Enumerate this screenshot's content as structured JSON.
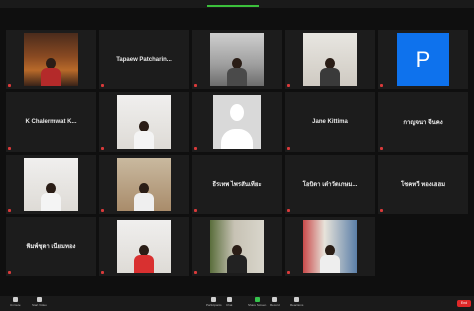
{
  "meeting": {
    "participants": [
      {
        "id": "t1",
        "name": "",
        "type": "video",
        "scene": "scene-red",
        "shirt": "#b42a2a"
      },
      {
        "id": "t2",
        "name": "Tapaew Patcharin...",
        "type": "name"
      },
      {
        "id": "t3",
        "name": "",
        "type": "video",
        "scene": "scene-grey",
        "shirt": "#4a4a4a"
      },
      {
        "id": "t4",
        "name": "",
        "type": "video",
        "scene": "scene-light",
        "shirt": "#3a3a3a"
      },
      {
        "id": "t5",
        "name": "",
        "type": "avatar",
        "initial": "P"
      },
      {
        "id": "t6",
        "name": "K Chalermwat  K...",
        "type": "name"
      },
      {
        "id": "t7",
        "name": "",
        "type": "video",
        "scene": "scene-wall",
        "shirt": "#f4f4f4"
      },
      {
        "id": "t8",
        "name": "",
        "type": "silhouette"
      },
      {
        "id": "t9",
        "name": "Jane Kittima",
        "type": "name"
      },
      {
        "id": "t10",
        "name": "กาญจนา จีนคง",
        "type": "name"
      },
      {
        "id": "t11",
        "name": "",
        "type": "video",
        "scene": "scene-wall",
        "shirt": "#f4f4f4"
      },
      {
        "id": "t12",
        "name": "",
        "type": "video",
        "scene": "scene-wood",
        "shirt": "#efefef"
      },
      {
        "id": "t13",
        "name": "ธีรเทพ ไพรสันเทียะ",
        "type": "name"
      },
      {
        "id": "t14",
        "name": "โอบิดา เต๋าวัดเกษม...",
        "type": "name"
      },
      {
        "id": "t15",
        "name": "โชคทวี ทองเฮฮม",
        "type": "name"
      },
      {
        "id": "t16",
        "name": "พิมพ์ชุดา เนียมทอง",
        "type": "name"
      },
      {
        "id": "t17",
        "name": "",
        "type": "video",
        "scene": "scene-wall",
        "shirt": "#d93030"
      },
      {
        "id": "t18",
        "name": "",
        "type": "video",
        "scene": "scene-tree",
        "shirt": "#222222"
      },
      {
        "id": "t19",
        "name": "",
        "type": "video",
        "scene": "scene-lightblue",
        "shirt": "#eeeeee"
      },
      {
        "id": "t20",
        "name": "",
        "type": "empty"
      }
    ]
  },
  "toolbar": {
    "buttons": [
      {
        "icon": "microphone-icon",
        "label": "Unmute",
        "green": false
      },
      {
        "icon": "video-camera-icon",
        "label": "Start Video",
        "green": false
      },
      {
        "icon": "participants-icon",
        "label": "Participants",
        "green": false
      },
      {
        "icon": "chat-icon",
        "label": "Chat",
        "green": false
      },
      {
        "icon": "share-screen-icon",
        "label": "Share Screen",
        "green": true
      },
      {
        "icon": "record-icon",
        "label": "Record",
        "green": false
      },
      {
        "icon": "reactions-icon",
        "label": "Reactions",
        "green": false
      }
    ],
    "end_label": "End"
  },
  "colors": {
    "accent_green": "#35c24c",
    "end_red": "#e02828",
    "avatar_blue": "#0e72ed"
  }
}
